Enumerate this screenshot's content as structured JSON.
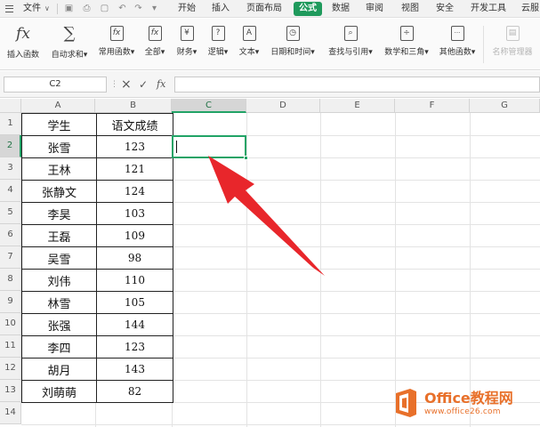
{
  "menubar": {
    "file_label": "文件",
    "tabs": [
      "开始",
      "插入",
      "页面布局",
      "公式",
      "数据",
      "审阅",
      "视图",
      "安全",
      "开发工具",
      "云服"
    ],
    "active_tab": "公式"
  },
  "ribbon": {
    "buttons": [
      {
        "label": "插入函数",
        "icon": "fx"
      },
      {
        "label": "自动求和",
        "icon": "∑"
      },
      {
        "label": "常用函数",
        "icon": "fx"
      },
      {
        "label": "全部",
        "icon": "fx"
      },
      {
        "label": "财务",
        "icon": "¥"
      },
      {
        "label": "逻辑",
        "icon": "?"
      },
      {
        "label": "文本",
        "icon": "A"
      },
      {
        "label": "日期和时间",
        "icon": "◷"
      },
      {
        "label": "查找与引用",
        "icon": "⌕"
      },
      {
        "label": "数学和三角",
        "icon": "÷"
      },
      {
        "label": "其他函数",
        "icon": "···"
      },
      {
        "label": "名称管理器",
        "icon": "▤"
      }
    ]
  },
  "formula_bar": {
    "cell_ref": "C2",
    "cancel_icon": "×",
    "confirm_icon": "✓",
    "fx_label": "fx",
    "value": ""
  },
  "sheet": {
    "columns": [
      "A",
      "B",
      "C",
      "D",
      "E",
      "F",
      "G"
    ],
    "rows": [
      "1",
      "2",
      "3",
      "4",
      "5",
      "6",
      "7",
      "8",
      "9",
      "10",
      "11",
      "12",
      "13",
      "14"
    ],
    "selected_column": "C",
    "selected_row": "2",
    "header": [
      "学生",
      "语文成绩"
    ],
    "data": [
      [
        "张雪",
        "123"
      ],
      [
        "王林",
        "121"
      ],
      [
        "张静文",
        "124"
      ],
      [
        "李昊",
        "103"
      ],
      [
        "王磊",
        "109"
      ],
      [
        "吴雪",
        "98"
      ],
      [
        "刘伟",
        "110"
      ],
      [
        "林雪",
        "105"
      ],
      [
        "张强",
        "144"
      ],
      [
        "李四",
        "123"
      ],
      [
        "胡月",
        "143"
      ],
      [
        "刘萌萌",
        "82"
      ]
    ]
  },
  "colors": {
    "accent": "#1f9a5c",
    "arrow": "#e8262b",
    "watermark": "#e8702a"
  },
  "watermark": {
    "title": "Office教程网",
    "url": "www.office26.com"
  }
}
